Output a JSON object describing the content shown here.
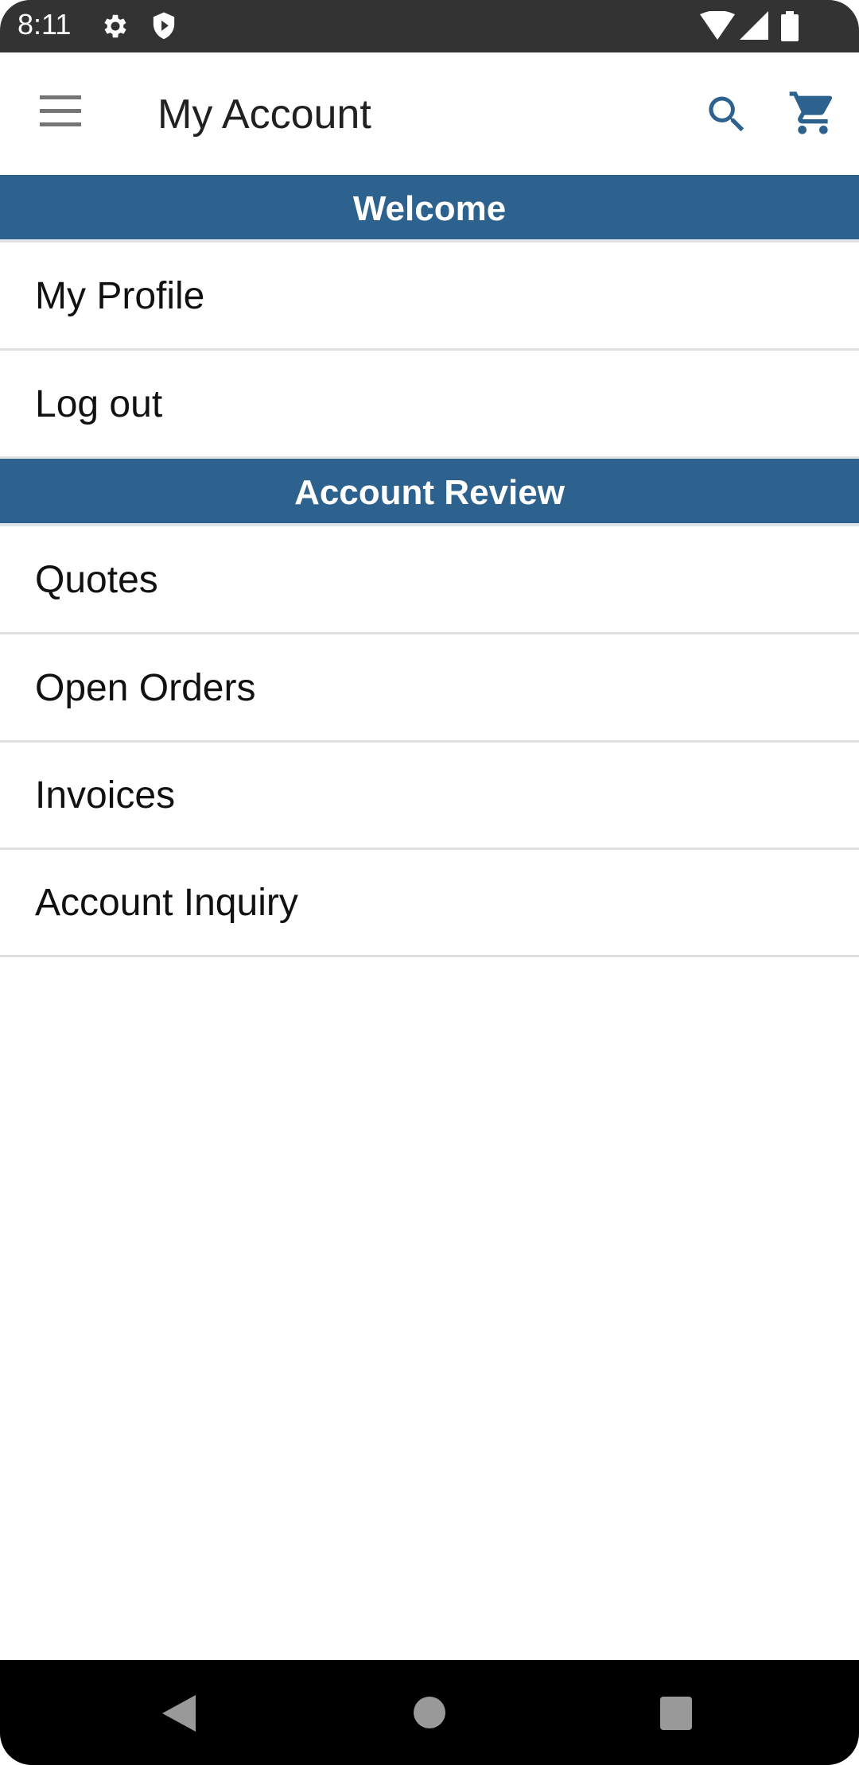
{
  "status_bar": {
    "time": "8:11",
    "left_icons": [
      "settings-icon",
      "shield-play-icon"
    ],
    "right_icons": [
      "wifi-icon",
      "signal-icon",
      "battery-icon"
    ]
  },
  "toolbar": {
    "menu_icon": "hamburger-menu-icon",
    "title": "My Account",
    "search_icon": "search-icon",
    "cart_icon": "shopping-cart-icon",
    "accent_color": "#2c628d"
  },
  "sections": [
    {
      "header": "Welcome",
      "items": [
        "My Profile",
        "Log out"
      ]
    },
    {
      "header": "Account Review",
      "items": [
        "Quotes",
        "Open Orders",
        "Invoices",
        "Account Inquiry"
      ]
    }
  ],
  "colors": {
    "section_header_bg": "#2c628d",
    "section_header_text": "#ffffff"
  },
  "nav_bar": {
    "buttons": [
      "back",
      "home",
      "recents"
    ]
  }
}
